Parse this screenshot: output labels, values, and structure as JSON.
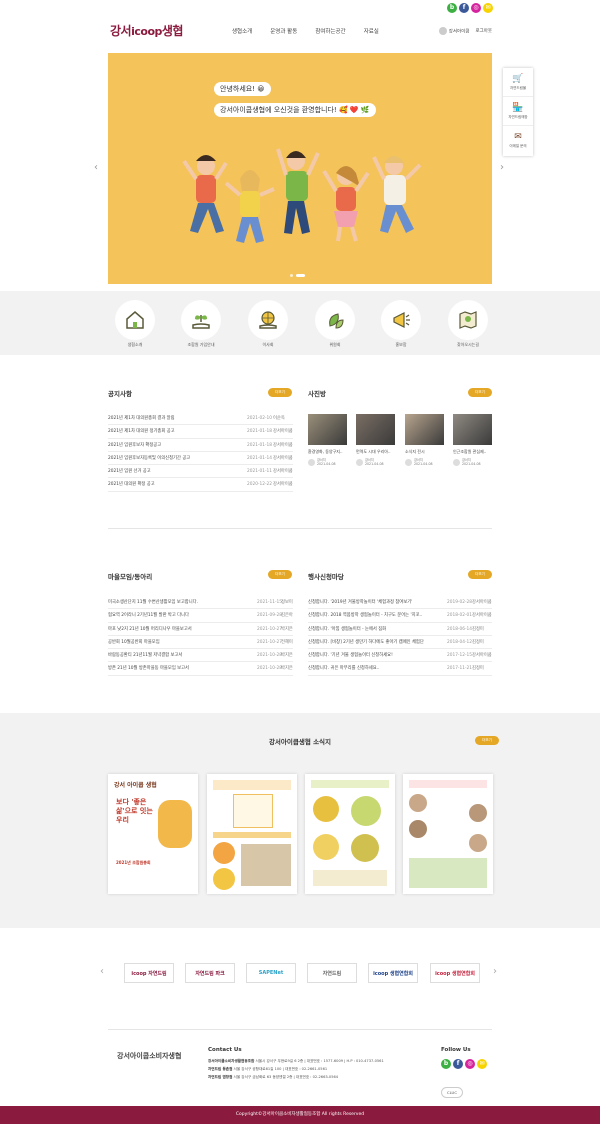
{
  "colors": {
    "brand": "#8a1a3e",
    "accent": "#e5a826",
    "hero_bg": "#f4c35a",
    "band_bg": "#f2f2f2"
  },
  "social": [
    {
      "name": "blog",
      "letter": "b",
      "color": "#3cb043"
    },
    {
      "name": "facebook",
      "letter": "f",
      "color": "#3b5998"
    },
    {
      "name": "instagram",
      "letter": "◎",
      "color": "#d6249f"
    },
    {
      "name": "kakaotalk",
      "letter": "✉",
      "color": "#f7d300"
    }
  ],
  "header": {
    "logo_part1": "강서",
    "logo_part2": "icoop",
    "logo_part3": "생협",
    "nav": [
      "생협소개",
      "운영과 활동",
      "참여하는공간",
      "자료실"
    ],
    "user": "강서아이쿱",
    "logout": "로그아웃"
  },
  "hero": {
    "bubble1": "안녕하세요! 😀",
    "bubble2": "강서아이쿱생협에 오신것을 환영합니다! 🥰 ❤️ 🌿",
    "prev": "‹",
    "next": "›"
  },
  "quick": [
    {
      "label": "자연드림몰",
      "icon": "cart-icon"
    },
    {
      "label": "자연드림매장",
      "icon": "store-icon"
    },
    {
      "label": "이메일 문의",
      "icon": "mail-icon"
    }
  ],
  "categories": [
    {
      "label": "생협소개",
      "icon": "house-icon"
    },
    {
      "label": "조합원 가입안내",
      "icon": "sprout-hand-icon"
    },
    {
      "label": "이사회",
      "icon": "globe-hand-icon"
    },
    {
      "label": "위원회",
      "icon": "leaves-icon"
    },
    {
      "label": "홍보함",
      "icon": "megaphone-icon"
    },
    {
      "label": "찾아오시는길",
      "icon": "map-pin-icon"
    }
  ],
  "notice": {
    "title": "공지사항",
    "more": "더보기",
    "items": [
      {
        "t": "2021년 제1차 대의원총회 결과 알림",
        "d": "2021-02-10",
        "a": "이순옥"
      },
      {
        "t": "2021년 제1차 대의원 정기총회 공고",
        "d": "2021-01-18",
        "a": "강서아이쿱"
      },
      {
        "t": "2021년 임원후보자 확정공고",
        "d": "2021-01-18",
        "a": "강서아이쿱"
      },
      {
        "t": "2021년 임원후보자등록및 이의신청기간 공고",
        "d": "2021-01-14",
        "a": "강서아이쿱"
      },
      {
        "t": "2021년 임원 선거 공고",
        "d": "2021-01-11",
        "a": "강서아이쿱"
      },
      {
        "t": "2021년 대의원 확정 공고",
        "d": "2020-12-22",
        "a": "강서아이쿱"
      }
    ]
  },
  "photos": {
    "title": "사진방",
    "more": "더보기",
    "items": [
      {
        "t": "환경영화, 동양구지..",
        "u": "강서지",
        "d": "2021-04-08",
        "c": "#9a8f7a"
      },
      {
        "t": "먼역도 시대 우리아..",
        "u": "강서지",
        "d": "2021-04-08",
        "c": "#7a6e64"
      },
      {
        "t": "소식지 전시",
        "u": "강서지",
        "d": "2021-04-08",
        "c": "#b8a58e"
      },
      {
        "t": "인근조합원 관심제..",
        "u": "강서지",
        "d": "2021-04-08",
        "c": "#8f8a82"
      }
    ]
  },
  "village": {
    "title": "마을모임/동아리",
    "more": "더보기",
    "items": [
      {
        "t": "미국소생산단지 11월 수변산생활모임 보고합니다.",
        "d": "2021-11-15",
        "a": "정보미"
      },
      {
        "t": "협요역 2이라니 2기년11월 발판 박고 다니다",
        "d": "2021-09-28",
        "a": "김은아"
      },
      {
        "t": "마포 낮2지 21년 10월 머리디나우 마을보고서",
        "d": "2021-10-27",
        "a": "박지은"
      },
      {
        "t": "공반회 10월공반회 마을모임",
        "d": "2021-10-27",
        "a": "전혜미"
      },
      {
        "t": "바람동공환티 21년11월 저녁결합 보고서",
        "d": "2021-10-28",
        "a": "박지은"
      },
      {
        "t": "방촌 21년 10월 방촌마을동 마을모임 보고서",
        "d": "2021-10-28",
        "a": "박지은"
      }
    ]
  },
  "events": {
    "title": "행사신청마당",
    "more": "더보기",
    "items": [
      {
        "t": "신청합니다. '2019년 겨울방학놀이터 '체험과정 참여보기'",
        "d": "2019-02-28",
        "a": "강서아이쿱"
      },
      {
        "t": "신청합니다. 2018 역봄방학 생협놀이터 - 치구도 문어는 '지꼬..",
        "d": "2018-02-01",
        "a": "강서아이쿱"
      },
      {
        "t": "신청합니다. '아낌 생협놀이터 - 눈에서 짐화",
        "d": "2018-06-14",
        "a": "김정미"
      },
      {
        "t": "신청합니다. [비창] 2기년 생만기 하다에도 좋아기 캠페인 체험단",
        "d": "2018-04-12",
        "a": "김정미"
      },
      {
        "t": "신청합니다. '기년 겨울 생협놀이터 신청하세요!",
        "d": "2017-12-15",
        "a": "강서아이쿱"
      },
      {
        "t": "신청합니다. 귀은 마무리를 신청하세요..",
        "d": "2017-11-21",
        "a": "김정미"
      }
    ]
  },
  "newsletter": {
    "title": "강서아이쿱생협 소식지",
    "more": "더보기",
    "cover1_title": "강서 아이쿱 생협",
    "cover1_headline": "보다 '좋은삶'으로 잇는 우리",
    "cover1_foot": "2021년 조합원총회"
  },
  "partners": [
    {
      "label": "icoop 자연드림",
      "color": "#8a1a3e"
    },
    {
      "label": "자연드림 파크",
      "color": "#8a1a3e"
    },
    {
      "label": "SAPENet",
      "color": "#2aa2c9"
    },
    {
      "label": "자연드림",
      "color": "#666"
    },
    {
      "label": "icoop 생협연합회",
      "color": "#1a3f8a"
    },
    {
      "label": "icoop 생협연합회",
      "color": "#c41e3a"
    }
  ],
  "partner_nav": {
    "prev": "‹",
    "next": "›"
  },
  "footer": {
    "name": "강서아이쿱소비자생협",
    "contact_title": "Contact Us",
    "rows": [
      {
        "name": "강서아이쿱소비자생활협동조합",
        "text": " 서울시 강서구 우현로9길 6 2층 | 대표번호 : 1577-6009 | H.P : 010-4737-0561"
      },
      {
        "name": "자연드림 등촌점",
        "text": " 서울 강서구 공항대로61길 100 | 대표번호 : 02-2661-0561"
      },
      {
        "name": "자연드림 염창점",
        "text": " 서울 강서구 금남화로 63 동양엔겔 2층 | 대표번호 : 02-2663-0564"
      }
    ],
    "follow_title": "Follow Us",
    "family": "CLUC",
    "copyright": "Copyright©강서아이쿱소비자생활협동조합 All rights Reserved"
  }
}
